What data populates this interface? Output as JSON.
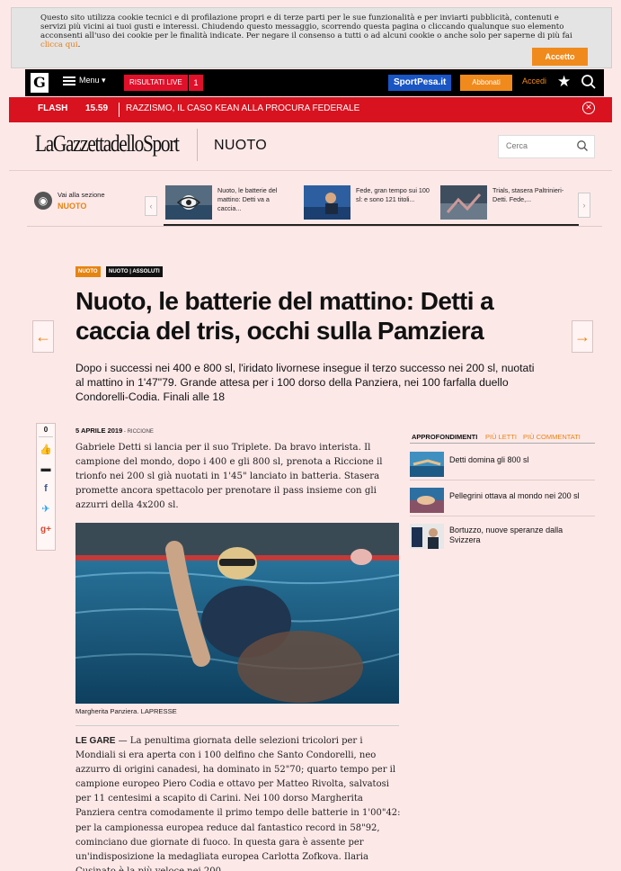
{
  "cookie": {
    "text": "Questo sito utilizza cookie tecnici e di profilazione propri e di terze parti per le sue funzionalità e per inviarti pubblicità, contenuti e servizi più vicini ai tuoi gusti e interessi. Chiudendo questo messaggio, scorrendo questa pagina o cliccando qualunque suo elemento acconsenti all'uso dei cookie per le finalità indicate. Per negare il consenso a tutti o ad alcuni cookie o anche solo per saperne di più fai",
    "link": "clicca qui",
    "accept": "Accetto"
  },
  "topnav": {
    "logo": "G",
    "menu": "Menu ▾",
    "live": "RISULTATI LIVE",
    "live_count": "1",
    "sportpesa": "SportPesa.it",
    "abbonati": "Abbonati",
    "accedi": "Accedi"
  },
  "flash": {
    "label": "FLASH",
    "time": "15.59",
    "news": "RAZZISMO, IL CASO KEAN ALLA PROCURA FEDERALE"
  },
  "header": {
    "brand": "LaGazzettadelloSport",
    "section": "NUOTO",
    "search_placeholder": "Cerca"
  },
  "carousel": {
    "goto": "Vai alla sezione",
    "section": "NUOTO",
    "items": [
      {
        "title": "Nuoto, le batterie del mattino: Detti va a caccia..."
      },
      {
        "title": "Fede, gran tempo sui 100 sl: e sono 121 titoli..."
      },
      {
        "title": "Trials, stasera Paltrinieri-Detti. Fede,..."
      }
    ]
  },
  "article": {
    "tags": [
      "NUOTO",
      "NUOTO | ASSOLUTI"
    ],
    "headline": "Nuoto, le batterie del mattino: Detti a caccia del tris, occhi sulla Pamziera",
    "subtitle": "Dopo i successi nei 400 e 800 sl, l'iridato livornese insegue il terzo successo nei 200 sl, nuotati al mattino in 1'47\"79. Grande attesa per i 100 dorso della Panziera, nei 100 farfalla duello Condorelli-Codia. Finali alle 18",
    "date": "5 APRILE 2019",
    "place": " - RICCIONE",
    "lead": "Gabriele Detti si lancia per il suo Triplete. Da bravo interista. Il campione del mondo, dopo i 400 e gli 800 sl, prenota a Riccione il trionfo nei 200 sl già nuotati in 1'45\" lanciato in batteria. Stasera promette ancora spettacolo per prenotare il pass insieme con gli azzurri della 4x200 sl.",
    "caption": "Margherita Panziera. LAPRESSE",
    "body_label": "LE GARE",
    "body": " — La penultima giornata delle selezioni tricolori per i Mondiali si era aperta con i 100 delfino che Santo Condorelli, neo azzurro di origini canadesi, ha dominato in 52\"70; quarto tempo per il campione europeo Piero Codia e ottavo per Matteo Rivolta, salvatosi per 11 centesimi a scapito di Carini. Nei 100 dorso Margherita Panziera centra comodamente il primo tempo delle batterie in 1'00\"42: per la campionessa europea reduce dal fantastico record in 58\"92, cominciano due giornate di fuoco. In questa gara è assente per un'indisposizione la medagliata europea Carlotta Zofkova. Ilaria Cusinato è la più veloce nei 200"
  },
  "share": {
    "count": "0"
  },
  "sidebar": {
    "tabs": [
      "APPROFONDIMENTI",
      "PIÙ LETTI",
      "PIÙ COMMENTATI"
    ],
    "items": [
      {
        "title": "Detti domina gli 800 sl"
      },
      {
        "title": "Pellegrini ottava al mondo nei 200 sl"
      },
      {
        "title": "Bortuzzo, nuove speranze dalla Svizzera"
      }
    ]
  },
  "colors": {
    "accent": "#e68410",
    "flash_red": "#d8121f",
    "background": "#fde8e8"
  }
}
